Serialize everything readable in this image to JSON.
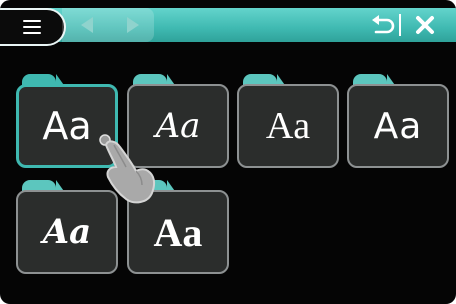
{
  "topbar": {
    "menu_icon": "hamburger-icon",
    "back_icon": "arrow-left-icon",
    "forward_icon": "arrow-right-icon",
    "undo_icon": "undo-icon",
    "close_icon": "close-icon",
    "accent_color": "#3fb9b1"
  },
  "fonts": [
    {
      "sample": "Aa",
      "selected": true
    },
    {
      "sample": "Aa",
      "selected": false
    },
    {
      "sample": "Aa",
      "selected": false
    },
    {
      "sample": "Aa",
      "selected": false
    },
    {
      "sample": "Aa",
      "selected": false
    },
    {
      "sample": "Aa",
      "selected": false
    }
  ],
  "pointer_icon": "hand-pointer-icon"
}
